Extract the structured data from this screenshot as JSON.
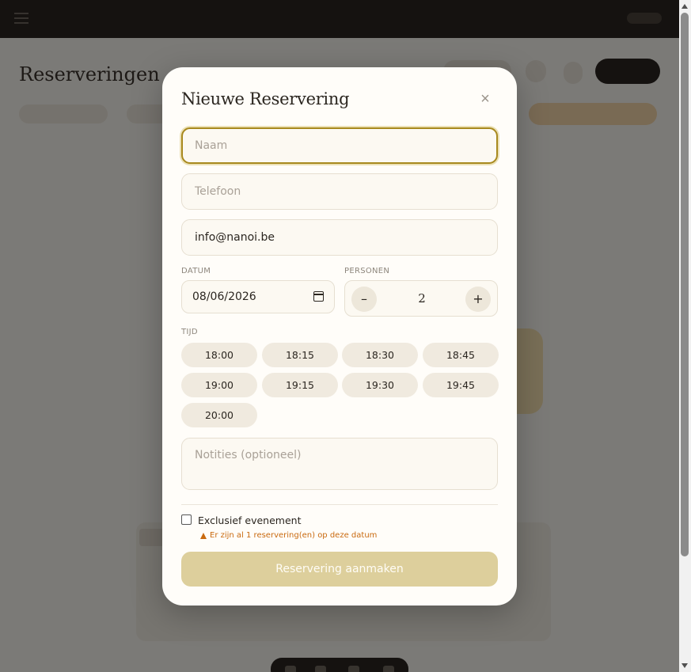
{
  "background": {
    "page_title": "Reserveringen"
  },
  "modal": {
    "title": "Nieuwe Reservering",
    "close_label": "×",
    "name_placeholder": "Naam",
    "phone_placeholder": "Telefoon",
    "email_value": "info@nanoi.be",
    "date_label": "DATUM",
    "date_value": "08/06/2026",
    "persons_label": "PERSONEN",
    "persons_minus": "–",
    "persons_value": "2",
    "persons_plus": "+",
    "time_label": "TIJD",
    "times": [
      "18:00",
      "18:15",
      "18:30",
      "18:45",
      "19:00",
      "19:15",
      "19:30",
      "19:45",
      "20:00"
    ],
    "notes_placeholder": "Notities (optioneel)",
    "exclusive_label": "Exclusief evenement",
    "warning_text": "Er zijn al 1 reservering(en) op deze datum",
    "submit_label": "Reservering aanmaken"
  },
  "colors": {
    "accent": "#a8891e",
    "submit_bg": "#ddcf9c",
    "warning": "#c96a10",
    "topbar": "#2a2420"
  },
  "icons": [
    "menu-icon",
    "close-icon",
    "calendar-icon",
    "warning-icon"
  ]
}
